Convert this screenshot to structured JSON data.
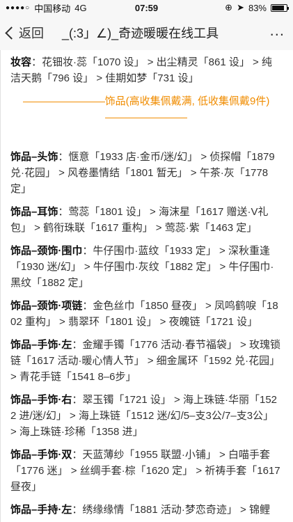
{
  "status_bar": {
    "signal_dots": "●●●●○",
    "carrier": "中国移动",
    "network": "4G",
    "time": "07:59",
    "battery_percent": "83%",
    "battery_level": 0.83
  },
  "nav": {
    "back_label": "返回",
    "title": "_(:3」∠)_奇迹暖暖在线工具",
    "more": "..."
  },
  "content": {
    "makeup": {
      "label": "妆容",
      "text": "：花钿妆·蕊「1070 设」 > 出尘精灵「861 设」 > 纯洁天鹅「796 设」 > 佳期如梦「731 设」"
    },
    "accessory_header": "饰品(高收集佩戴满, 低收集佩戴9件)",
    "items": [
      {
        "label": "饰品–头饰",
        "text": "：惬意「1933 店·金币/迷/幻」 > 侦探帽「1879 兑·花园」 > 风卷墨情结「1801 暂无」 > 午茶·灰「1778 定」"
      },
      {
        "label": "饰品–耳饰",
        "text": "：莺蕊「1801 设」 > 海沫星「1617 赠送·V礼包」 > 鹤衔珠联「1617 重构」 > 莺蕊·紫「1463 定」"
      },
      {
        "label": "饰品–颈饰·围巾",
        "text": "：牛仔围巾·蓝纹「1933 定」 > 深秋重逢「1930 迷/幻」 > 牛仔围巾·灰纹「1882 定」 > 牛仔围巾·黑纹「1882 定」"
      },
      {
        "label": "饰品–颈饰·项链",
        "text": "：金色丝巾「1850 昼夜」 > 凤鸣鹤唳「1802 重构」 > 翡翠环「1801 设」 > 夜魄链「1721 设」"
      },
      {
        "label": "饰品–手饰·左",
        "text": "：金耀手镯「1776 活动·春节福袋」 > 玫瑰锁链「1617 活动·暖心情人节」 > 细金属环「1592 兑·花园」 > 青花手链「1541 8–6步」"
      },
      {
        "label": "饰品–手饰·右",
        "text": "：翠玉镯「1721 设」 > 海上珠链·华丽「1522 进/迷/幻」 > 海上珠链「1512 迷/幻/5–支3公/7–支3公」 > 海上珠链·珍稀「1358 进」"
      },
      {
        "label": "饰品–手饰·双",
        "text": "：天蓝薄纱「1955 联盟·小铺」 > 白喵手套「1776 迷」 > 丝绸手套·棕「1620 定」 > 祈祷手套「1617 昼夜」"
      },
      {
        "label": "饰品–手持·左",
        "text": "：绣缘缘情「1881 活动·梦恋奇迹」 > 锦鲤"
      }
    ]
  }
}
